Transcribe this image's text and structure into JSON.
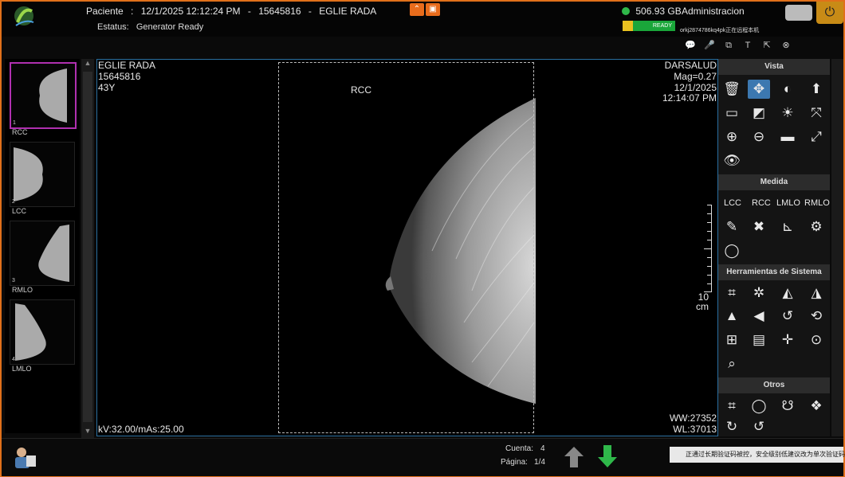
{
  "header": {
    "patient_label": "Paciente",
    "separator": ":",
    "datetime": "12/1/2025 12:12:24 PM",
    "patient_id": "15645816",
    "patient_name": "EGLIE RADA",
    "status_label": "Estatus:",
    "status_value": "Generator Ready",
    "disk_free": "506.93 GB",
    "user": "Administracion",
    "ready_badge": "READY",
    "remote_notice": "orkj2874786kq4pk正在远程本机"
  },
  "thumbnails": [
    {
      "index": "1",
      "label": "RCC",
      "active": true
    },
    {
      "index": "2",
      "label": "LCC",
      "active": false
    },
    {
      "index": "3",
      "label": "RMLO",
      "active": false
    },
    {
      "index": "4",
      "label": "LMLO",
      "active": false
    }
  ],
  "viewer": {
    "patient_name": "EGLIE RADA",
    "patient_id": "15645816",
    "age": "43Y",
    "view_label": "RCC",
    "institution": "DARSALUD",
    "magnification": "Mag=0.27",
    "date": "12/1/2025",
    "time": "12:14:07 PM",
    "exposure": "kV:32.00/mAs:25.00",
    "window_width": "WW:27352",
    "window_level": "WL:37013",
    "ruler_value": "10",
    "ruler_unit": "cm"
  },
  "panel": {
    "vista_title": "Vista",
    "medida_title": "Medida",
    "medida_views": [
      "LCC",
      "RCC",
      "LMLO",
      "RMLO"
    ],
    "sistema_title": "Herramientas de Sistema",
    "otros_title": "Otros"
  },
  "footer": {
    "count_label": "Cuenta:",
    "count_value": "4",
    "page_label": "Página:",
    "page_value": "1/4",
    "notice": "正通过长期验证码被控，安全级别低建议改为单次验证码"
  },
  "colors": {
    "frame": "#e0701a",
    "selected_tool": "#3c78b0",
    "active_thumb": "#b030b0",
    "ready_green": "#1aa63a",
    "arrow_green": "#2fb84a"
  }
}
